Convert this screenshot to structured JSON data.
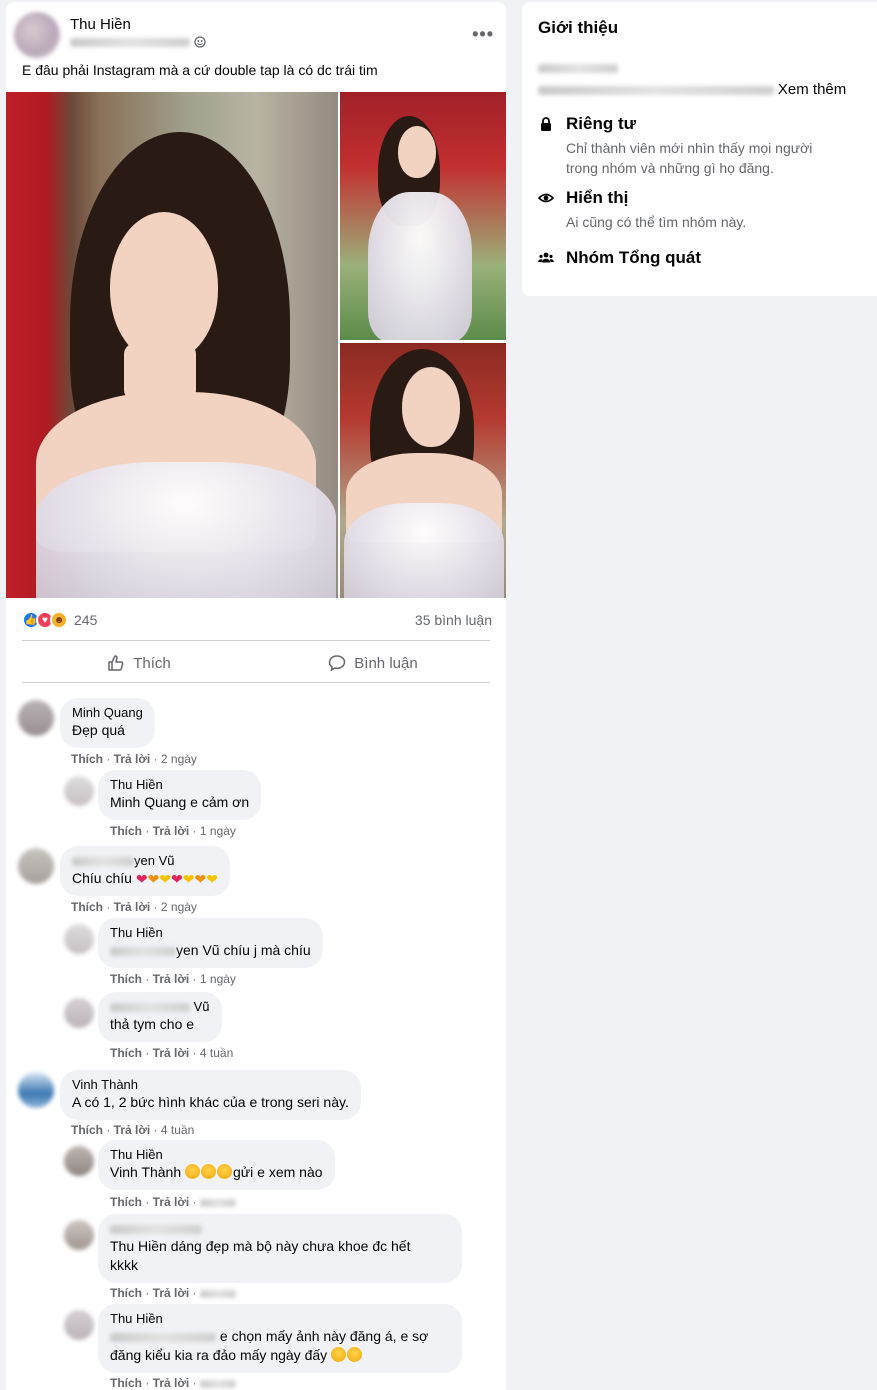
{
  "post": {
    "author": "Thu Hiền",
    "text": "E đâu phải Instagram mà a cứ double tap là có dc trái tim",
    "reactions_count": "245",
    "comments_count": "35 bình luận",
    "actions": {
      "like": "Thích",
      "comment": "Bình luận"
    }
  },
  "comments": [
    {
      "name": "Minh Quang",
      "text": "Đẹp quá",
      "like": "Thích",
      "reply": "Trả lời",
      "time": "2 ngày"
    },
    {
      "name": "Thu Hiền",
      "mention": "Minh Quang",
      "text": " e cảm ơn",
      "like": "Thích",
      "reply": "Trả lời",
      "time": "1 ngày"
    },
    {
      "name_suffix": "yen Vũ",
      "text": "Chíu chíu ",
      "like": "Thích",
      "reply": "Trả lời",
      "time": "2 ngày"
    },
    {
      "name": "Thu Hiền",
      "mention_suffix": "yen Vũ",
      "text": " chíu j mà chíu",
      "like": "Thích",
      "reply": "Trả lời",
      "time": "1 ngày"
    },
    {
      "name_suffix": "Vũ",
      "text": "thả tym cho e",
      "like": "Thích",
      "reply": "Trả lời",
      "time": "4 tuần"
    },
    {
      "name": "Vinh Thành",
      "text": "A có 1, 2 bức hình khác của e trong seri này.",
      "like": "Thích",
      "reply": "Trả lời",
      "time": "4 tuần"
    },
    {
      "name": "Thu Hiền",
      "mention": "Vinh Thành",
      "text": "gửi e xem nào",
      "like": "Thích",
      "reply": "Trả lời"
    },
    {
      "mention": "Thu Hiền",
      "text_line1": " dáng đẹp mà bộ này chưa khoe đc hết",
      "text_line2": "kkkk",
      "like": "Thích",
      "reply": "Trả lời"
    },
    {
      "name": "Thu Hiền",
      "text_line1": "e chọn mấy ảnh này đăng á, e sợ",
      "text_line2": "đăng kiểu kia ra đảo mấy ngày đấy ",
      "like": "Thích",
      "reply": "Trả lời"
    }
  ],
  "about": {
    "title": "Giới thiệu",
    "see_more": "Xem thêm",
    "privacy_label": "Riêng tư",
    "privacy_desc": "Chỉ thành viên mới nhìn thấy mọi người trong nhóm và những gì họ đăng.",
    "visibility_label": "Hiển thị",
    "visibility_desc": "Ai cũng có thể tìm nhóm này.",
    "group_type": "Nhóm Tổng quát"
  },
  "icons": {
    "more": "more-horizontal-icon",
    "privacy": "lock-icon",
    "visibility": "eye-icon",
    "group": "people-icon",
    "like": "thumbs-up-icon",
    "comment": "speech-bubble-icon"
  },
  "colors": {
    "accent": "#1877f2",
    "love": "#f33e58",
    "haha": "#f7b125",
    "secondary_text": "#65676b",
    "bubble": "#f0f2f5"
  }
}
